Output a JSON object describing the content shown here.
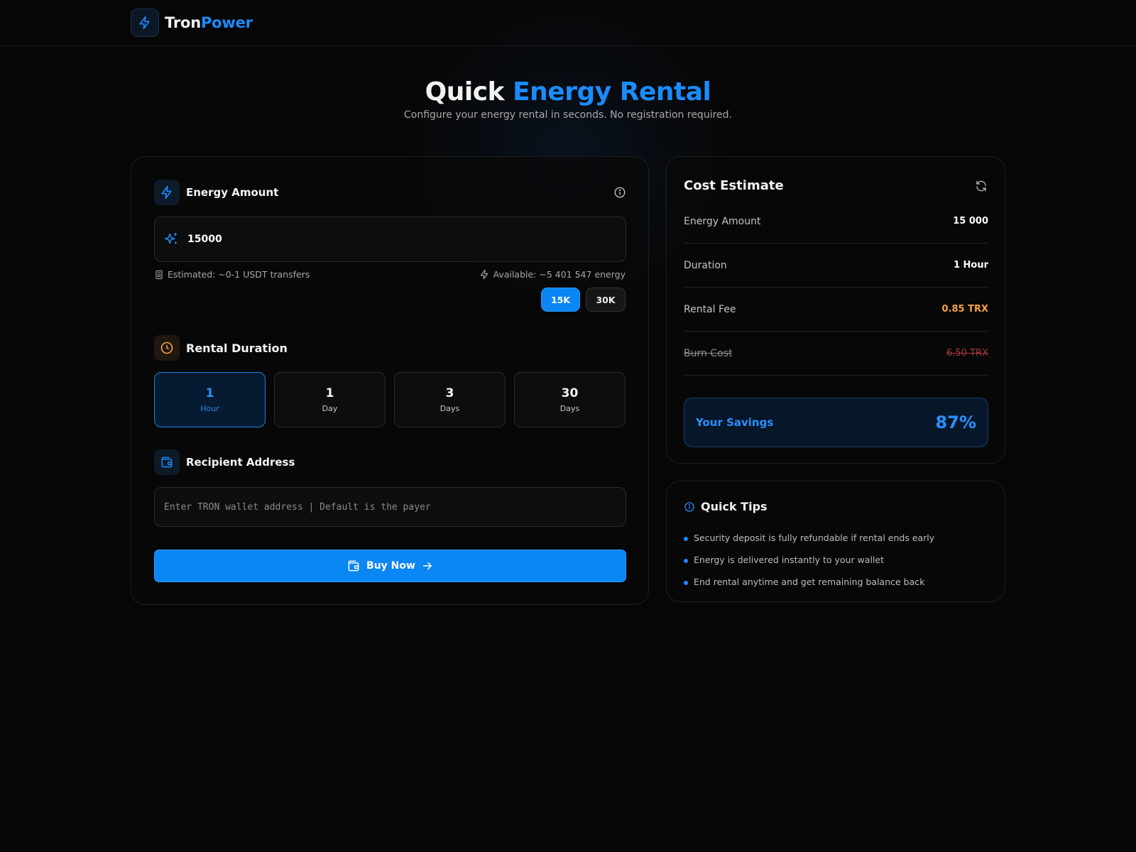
{
  "brand": {
    "part1": "Tron",
    "part2": "Power"
  },
  "hero": {
    "title_plain": "Quick",
    "title_accent": "Energy Rental",
    "subtitle": "Configure your energy rental in seconds. No registration required."
  },
  "energy": {
    "heading": "Energy Amount",
    "value": "15000",
    "estimated": "Estimated: ~0-1 USDT transfers",
    "available": "Available: ~5 401 547 energy",
    "presets": [
      "15K",
      "30K"
    ],
    "selected_preset": "15K"
  },
  "duration": {
    "heading": "Rental Duration",
    "options": [
      {
        "num": "1",
        "unit": "Hour"
      },
      {
        "num": "1",
        "unit": "Day"
      },
      {
        "num": "3",
        "unit": "Days"
      },
      {
        "num": "30",
        "unit": "Days"
      }
    ],
    "selected": "1 Hour"
  },
  "recipient": {
    "heading": "Recipient Address",
    "placeholder": "Enter TRON wallet address | Default is the payer",
    "value": ""
  },
  "buy": {
    "label": "Buy Now"
  },
  "cost": {
    "title": "Cost Estimate",
    "rows": [
      {
        "label": "Energy Amount",
        "value": "15 000"
      },
      {
        "label": "Duration",
        "value": "1 Hour"
      },
      {
        "label": "Rental Fee",
        "value": "0.85 TRX"
      },
      {
        "label": "Burn Cost",
        "value": "6.50 TRX"
      }
    ],
    "savings_label": "Your Savings",
    "savings_value": "87%"
  },
  "tips": {
    "title": "Quick Tips",
    "items": [
      "Security deposit is fully refundable if rental ends early",
      "Energy is delivered instantly to your wallet",
      "End rental anytime and get remaining balance back"
    ]
  },
  "icons": {
    "brand": "bolt-icon",
    "energy": "bolt-icon",
    "info": "info-icon",
    "input": "sparkles-icon",
    "estimate": "calculator-icon",
    "available": "bolt-icon",
    "duration": "clock-icon",
    "recipient": "wallet-icon",
    "buy_left": "wallet-icon",
    "buy_right": "arrow-right-icon",
    "refresh": "refresh-icon",
    "tips": "info-icon"
  },
  "colors": {
    "accent": "#1a8cff",
    "button": "#0a86f5",
    "fee": "#f5a53f",
    "burn": "#a73a3a",
    "background": "#060606"
  }
}
